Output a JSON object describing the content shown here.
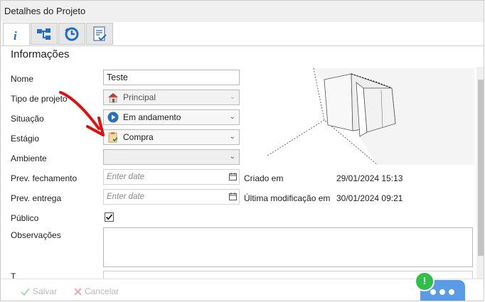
{
  "window": {
    "title": "Detalhes do Projeto"
  },
  "tabs": [
    {
      "icon": "info-icon",
      "active": true
    },
    {
      "icon": "hierarchy-icon",
      "active": false
    },
    {
      "icon": "history-icon",
      "active": false
    },
    {
      "icon": "checklist-icon",
      "active": false
    }
  ],
  "section": {
    "title": "Informações"
  },
  "form": {
    "nome": {
      "label": "Nome",
      "value": "Teste"
    },
    "tipo": {
      "label": "Tipo de projeto",
      "value": "Principal",
      "icon": "house-icon",
      "disabled": true
    },
    "situacao": {
      "label": "Situação",
      "value": "Em andamento",
      "icon": "play-circle-icon"
    },
    "estagio": {
      "label": "Estágio",
      "value": "Compra",
      "icon": "clipboard-icon"
    },
    "ambiente": {
      "label": "Ambiente",
      "value": ""
    },
    "prev_fechamento": {
      "label": "Prev. fechamento",
      "placeholder": "Enter date"
    },
    "prev_entrega": {
      "label": "Prev. entrega",
      "placeholder": "Enter date"
    },
    "publico": {
      "label": "Público",
      "checked": true
    },
    "observacoes": {
      "label": "Observações",
      "value": ""
    },
    "partial_label": "T"
  },
  "meta": {
    "criado_label": "Criado em",
    "criado_value": "29/01/2024 15:13",
    "modificado_label": "Última modificação em",
    "modificado_value": "30/01/2024 09:21"
  },
  "footer": {
    "save_label": "Salvar",
    "cancel_label": "Cancelar"
  },
  "chat": {
    "badge": "!"
  },
  "colors": {
    "accent": "#5a9be8",
    "badge": "#2fbf4b",
    "arrow": "#e01010"
  }
}
